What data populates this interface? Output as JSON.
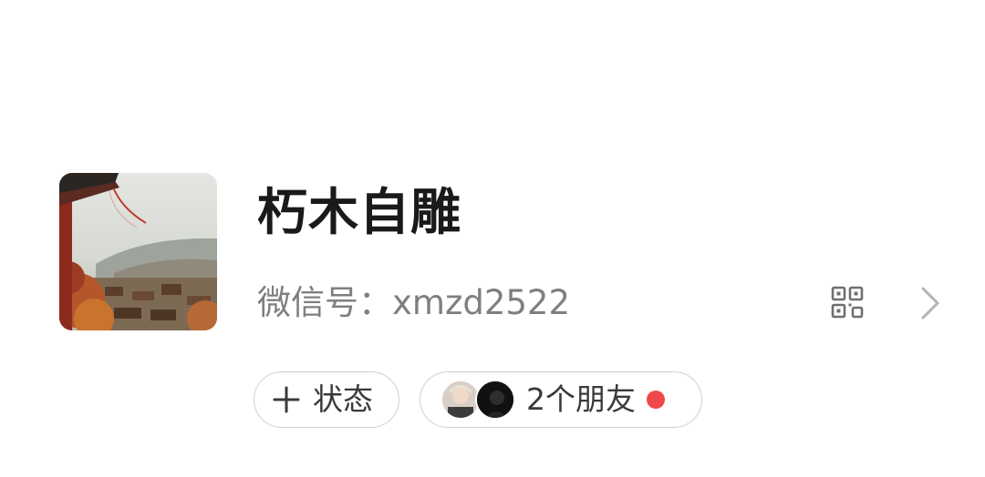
{
  "profile": {
    "nickname": "朽木自雕",
    "wechat_id_label": "微信号：",
    "wechat_id": "xmzd2522",
    "avatar_icon": "avatar-image",
    "qr_icon": "qr-code-icon",
    "chevron_icon": "chevron-right-icon"
  },
  "status_button": {
    "icon": "plus-icon",
    "label": "状态"
  },
  "friends_button": {
    "label": "2个朋友",
    "badge_color": "#f04848"
  },
  "colors": {
    "nickname": "#1a1a1a",
    "secondary_text": "#7f7f7f",
    "pill_border": "#cfcfcf"
  }
}
